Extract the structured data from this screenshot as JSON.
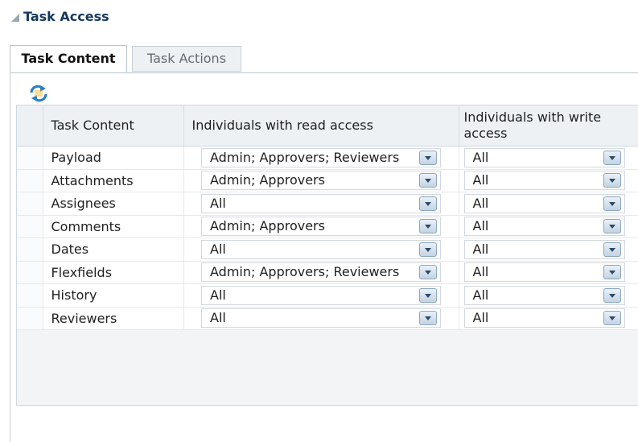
{
  "section": {
    "title": "Task Access"
  },
  "tabs": [
    {
      "label": "Task Content",
      "active": true
    },
    {
      "label": "Task Actions",
      "active": false
    }
  ],
  "toolbar": {
    "refresh_icon": "refresh-icon"
  },
  "table": {
    "columns": [
      "Task Content",
      "Individuals with read access",
      "Individuals with write access"
    ],
    "rows": [
      {
        "name": "Payload",
        "read": "Admin; Approvers; Reviewers",
        "write": "All"
      },
      {
        "name": "Attachments",
        "read": "Admin; Approvers",
        "write": "All"
      },
      {
        "name": "Assignees",
        "read": "All",
        "write": "All"
      },
      {
        "name": "Comments",
        "read": "Admin; Approvers",
        "write": "All"
      },
      {
        "name": "Dates",
        "read": "All",
        "write": "All"
      },
      {
        "name": "Flexfields",
        "read": "Admin; Approvers; Reviewers",
        "write": "All"
      },
      {
        "name": "History",
        "read": "All",
        "write": "All"
      },
      {
        "name": "Reviewers",
        "read": "All",
        "write": "All"
      }
    ]
  },
  "colors": {
    "accent": "#16385c",
    "border": "#c7cfd7",
    "grid_bg": "#f2f4f6"
  }
}
